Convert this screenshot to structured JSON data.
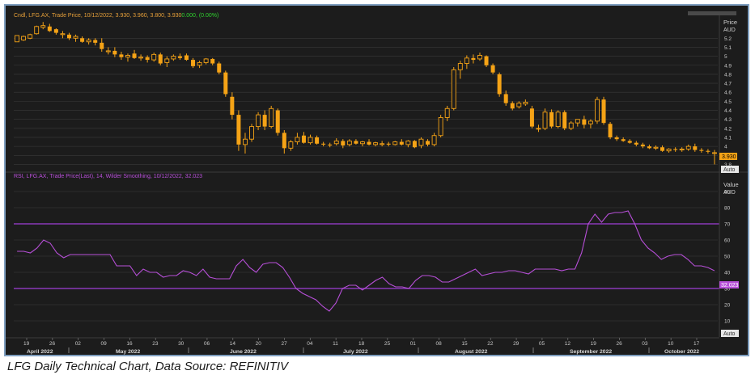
{
  "caption": "LFG Daily Technical Chart, Data Source: REFINITIV",
  "colors": {
    "candle": "#f5a316",
    "rsi": "#b74fd8",
    "band": "#8a38b8",
    "grid": "#3a3a3a",
    "text": "#c9c9c9",
    "change": "#2fd22f"
  },
  "price_panel": {
    "legend_prefix": "Cndl, LFG.AX, Trade Price, 10/12/2022, 3.930, 3.960, 3.800, 3.930",
    "legend_change": "0.000, (0.00%)",
    "axis_title": "Price",
    "axis_unit": "AUD",
    "last_label": "3.930",
    "auto_label": "Auto"
  },
  "rsi_panel": {
    "legend": "RSI, LFG.AX, Trade Price(Last), 14, Wilder Smoothing, 10/12/2022, 32.023",
    "axis_title": "Value",
    "axis_unit": "AUD",
    "last_label": "32.023",
    "auto_label": "Auto"
  },
  "chart_data": [
    {
      "type": "candlestick",
      "title": "Cndl, LFG.AX, Trade Price",
      "ylabel": "Price AUD",
      "ylim": [
        3.75,
        5.4
      ],
      "yticks": [
        3.8,
        3.9,
        4,
        4.1,
        4.2,
        4.3,
        4.4,
        4.5,
        4.6,
        4.7,
        4.8,
        4.9,
        5,
        5.1,
        5.2
      ],
      "day_ticks": [
        "19",
        "26",
        "02",
        "09",
        "16",
        "23",
        "30",
        "06",
        "14",
        "20",
        "27",
        "04",
        "11",
        "18",
        "25",
        "01",
        "08",
        "15",
        "22",
        "29",
        "05",
        "12",
        "19",
        "26",
        "03",
        "10",
        "17"
      ],
      "month_labels": [
        "April 2022",
        "May 2022",
        "June 2022",
        "July 2022",
        "August 2022",
        "September 2022",
        "October 2022"
      ],
      "last": {
        "date": "10/12/2022",
        "open": 3.93,
        "high": 3.96,
        "low": 3.8,
        "close": 3.93
      },
      "candles": [
        [
          5.16,
          5.23,
          5.16,
          5.23
        ],
        [
          5.18,
          5.23,
          5.17,
          5.22
        ],
        [
          5.2,
          5.25,
          5.19,
          5.24
        ],
        [
          5.25,
          5.34,
          5.24,
          5.33
        ],
        [
          5.32,
          5.38,
          5.3,
          5.34
        ],
        [
          5.33,
          5.36,
          5.27,
          5.28
        ],
        [
          5.3,
          5.31,
          5.24,
          5.26
        ],
        [
          5.24,
          5.28,
          5.2,
          5.25
        ],
        [
          5.24,
          5.26,
          5.18,
          5.2
        ],
        [
          5.2,
          5.24,
          5.16,
          5.22
        ],
        [
          5.2,
          5.22,
          5.15,
          5.16
        ],
        [
          5.16,
          5.2,
          5.13,
          5.18
        ],
        [
          5.18,
          5.2,
          5.12,
          5.15
        ],
        [
          5.15,
          5.2,
          5.05,
          5.08
        ],
        [
          5.05,
          5.1,
          5.02,
          5.06
        ],
        [
          5.06,
          5.1,
          4.99,
          5.02
        ],
        [
          5.02,
          5.05,
          4.96,
          4.99
        ],
        [
          4.99,
          5.03,
          4.94,
          5.01
        ],
        [
          5.03,
          5.07,
          4.97,
          4.98
        ],
        [
          4.98,
          5.02,
          4.95,
          4.99
        ],
        [
          4.99,
          5.01,
          4.93,
          4.96
        ],
        [
          4.96,
          5.04,
          4.94,
          5.02
        ],
        [
          5.02,
          5.04,
          4.9,
          4.92
        ],
        [
          4.93,
          5,
          4.88,
          4.97
        ],
        [
          4.97,
          5.02,
          4.95,
          5
        ],
        [
          5,
          5.03,
          4.96,
          4.98
        ],
        [
          5.01,
          5.03,
          4.95,
          4.96
        ],
        [
          4.96,
          4.98,
          4.87,
          4.89
        ],
        [
          4.9,
          4.95,
          4.87,
          4.93
        ],
        [
          4.93,
          4.98,
          4.91,
          4.97
        ],
        [
          4.97,
          4.98,
          4.9,
          4.92
        ],
        [
          4.92,
          4.94,
          4.8,
          4.82
        ],
        [
          4.82,
          4.84,
          4.55,
          4.58
        ],
        [
          4.55,
          4.6,
          4.3,
          4.35
        ],
        [
          4.35,
          4.4,
          3.95,
          4.02
        ],
        [
          4.02,
          4.15,
          3.92,
          4.08
        ],
        [
          4.08,
          4.25,
          4.05,
          4.22
        ],
        [
          4.22,
          4.38,
          4.18,
          4.35
        ],
        [
          4.35,
          4.4,
          4.18,
          4.22
        ],
        [
          4.22,
          4.45,
          4.2,
          4.42
        ],
        [
          4.4,
          4.42,
          4.12,
          4.15
        ],
        [
          4.15,
          4.18,
          3.92,
          3.98
        ],
        [
          3.98,
          4.07,
          3.95,
          4.05
        ],
        [
          4.05,
          4.15,
          4.02,
          4.1
        ],
        [
          4.12,
          4.16,
          4.03,
          4.04
        ],
        [
          4.04,
          4.13,
          4.02,
          4.1
        ],
        [
          4.1,
          4.12,
          4.02,
          4.03
        ],
        [
          4.03,
          4.05,
          4,
          4.02
        ],
        [
          4.02,
          4.04,
          3.99,
          4.01
        ],
        [
          4.03,
          4.09,
          4.01,
          4.06
        ],
        [
          4.06,
          4.08,
          3.98,
          4.01
        ],
        [
          4.02,
          4.08,
          4,
          4.06
        ],
        [
          4.06,
          4.08,
          4.02,
          4.03
        ],
        [
          4.03,
          4.06,
          4,
          4.05
        ],
        [
          4.05,
          4.08,
          4.01,
          4.02
        ],
        [
          4.02,
          4.05,
          4,
          4.04
        ],
        [
          4.02,
          4.06,
          4,
          4.03
        ],
        [
          4.03,
          4.05,
          4,
          4.02
        ],
        [
          4.02,
          4.06,
          4.01,
          4.05
        ],
        [
          4.05,
          4.08,
          4.01,
          4.02
        ],
        [
          4.02,
          4.07,
          3.99,
          4.06
        ],
        [
          4.06,
          4.07,
          3.98,
          3.99
        ],
        [
          4.01,
          4.1,
          3.98,
          4.08
        ],
        [
          4.06,
          4.08,
          4,
          4.02
        ],
        [
          4.02,
          4.15,
          4,
          4.12
        ],
        [
          4.12,
          4.35,
          4.1,
          4.32
        ],
        [
          4.32,
          4.45,
          4.28,
          4.42
        ],
        [
          4.42,
          4.88,
          4.4,
          4.85
        ],
        [
          4.85,
          4.95,
          4.75,
          4.92
        ],
        [
          4.92,
          5.01,
          4.86,
          4.98
        ],
        [
          4.98,
          5.02,
          4.92,
          4.96
        ],
        [
          4.97,
          5.04,
          4.95,
          5.01
        ],
        [
          5,
          5.01,
          4.88,
          4.9
        ],
        [
          4.9,
          4.92,
          4.8,
          4.82
        ],
        [
          4.8,
          4.82,
          4.55,
          4.58
        ],
        [
          4.58,
          4.62,
          4.45,
          4.48
        ],
        [
          4.48,
          4.5,
          4.4,
          4.42
        ],
        [
          4.44,
          4.5,
          4.42,
          4.48
        ],
        [
          4.47,
          4.52,
          4.45,
          4.49
        ],
        [
          4.42,
          4.45,
          4.2,
          4.22
        ],
        [
          4.2,
          4.24,
          4.16,
          4.2
        ],
        [
          4.2,
          4.42,
          4.18,
          4.38
        ],
        [
          4.38,
          4.41,
          4.2,
          4.22
        ],
        [
          4.22,
          4.4,
          4.2,
          4.38
        ],
        [
          4.38,
          4.4,
          4.18,
          4.2
        ],
        [
          4.2,
          4.28,
          4.18,
          4.26
        ],
        [
          4.26,
          4.3,
          4.22,
          4.3
        ],
        [
          4.3,
          4.34,
          4.2,
          4.24
        ],
        [
          4.25,
          4.3,
          4.2,
          4.28
        ],
        [
          4.28,
          4.55,
          4.25,
          4.52
        ],
        [
          4.52,
          4.55,
          4.24,
          4.26
        ],
        [
          4.25,
          4.27,
          4.08,
          4.1
        ],
        [
          4.1,
          4.12,
          4.06,
          4.08
        ],
        [
          4.08,
          4.1,
          4.05,
          4.06
        ],
        [
          4.06,
          4.08,
          4.03,
          4.04
        ],
        [
          4.04,
          4.06,
          4,
          4.02
        ],
        [
          4.02,
          4.04,
          3.98,
          4
        ],
        [
          4,
          4.02,
          3.97,
          3.98
        ],
        [
          3.98,
          4.01,
          3.96,
          3.99
        ],
        [
          3.99,
          4.01,
          3.94,
          3.95
        ],
        [
          3.95,
          3.98,
          3.93,
          3.97
        ],
        [
          3.97,
          3.99,
          3.94,
          3.96
        ],
        [
          3.96,
          3.99,
          3.94,
          3.97
        ],
        [
          3.97,
          4.02,
          3.95,
          4
        ],
        [
          4,
          4.03,
          3.94,
          3.96
        ],
        [
          3.96,
          3.98,
          3.93,
          3.95
        ],
        [
          3.95,
          3.97,
          3.92,
          3.94
        ],
        [
          3.93,
          3.96,
          3.8,
          3.93
        ]
      ]
    },
    {
      "type": "line",
      "title": "RSI, LFG.AX, Trade Price(Last), 14, Wilder Smoothing",
      "ylabel": "Value AUD",
      "ylim": [
        0,
        96
      ],
      "yticks": [
        10,
        20,
        30,
        40,
        50,
        60,
        70,
        80,
        90
      ],
      "reference_lines": [
        70,
        30
      ],
      "last": {
        "date": "10/12/2022",
        "value": 32.023
      },
      "series": [
        {
          "values": [
            53,
            53,
            52,
            55,
            60,
            58,
            52,
            49,
            51,
            51,
            51,
            51,
            51,
            51,
            51,
            44,
            44,
            44,
            38,
            42,
            40,
            40,
            37,
            38,
            38,
            41,
            40,
            38,
            42,
            37,
            36,
            36,
            36,
            44,
            48,
            43,
            40,
            45,
            46,
            46,
            43,
            37,
            30,
            27,
            25,
            23,
            19,
            16,
            21,
            30,
            32,
            32,
            29,
            32,
            35,
            37,
            33,
            31,
            31,
            30,
            35,
            38,
            38,
            37,
            34,
            34,
            36,
            38,
            40,
            42,
            38,
            39,
            40,
            40,
            41,
            41,
            40,
            39,
            42,
            42,
            42,
            42,
            41,
            42,
            42,
            52,
            70,
            76,
            71,
            76,
            77,
            77,
            78,
            70,
            60,
            55,
            52,
            48,
            50,
            51,
            51,
            48,
            44,
            44,
            43,
            41
          ]
        }
      ]
    }
  ]
}
